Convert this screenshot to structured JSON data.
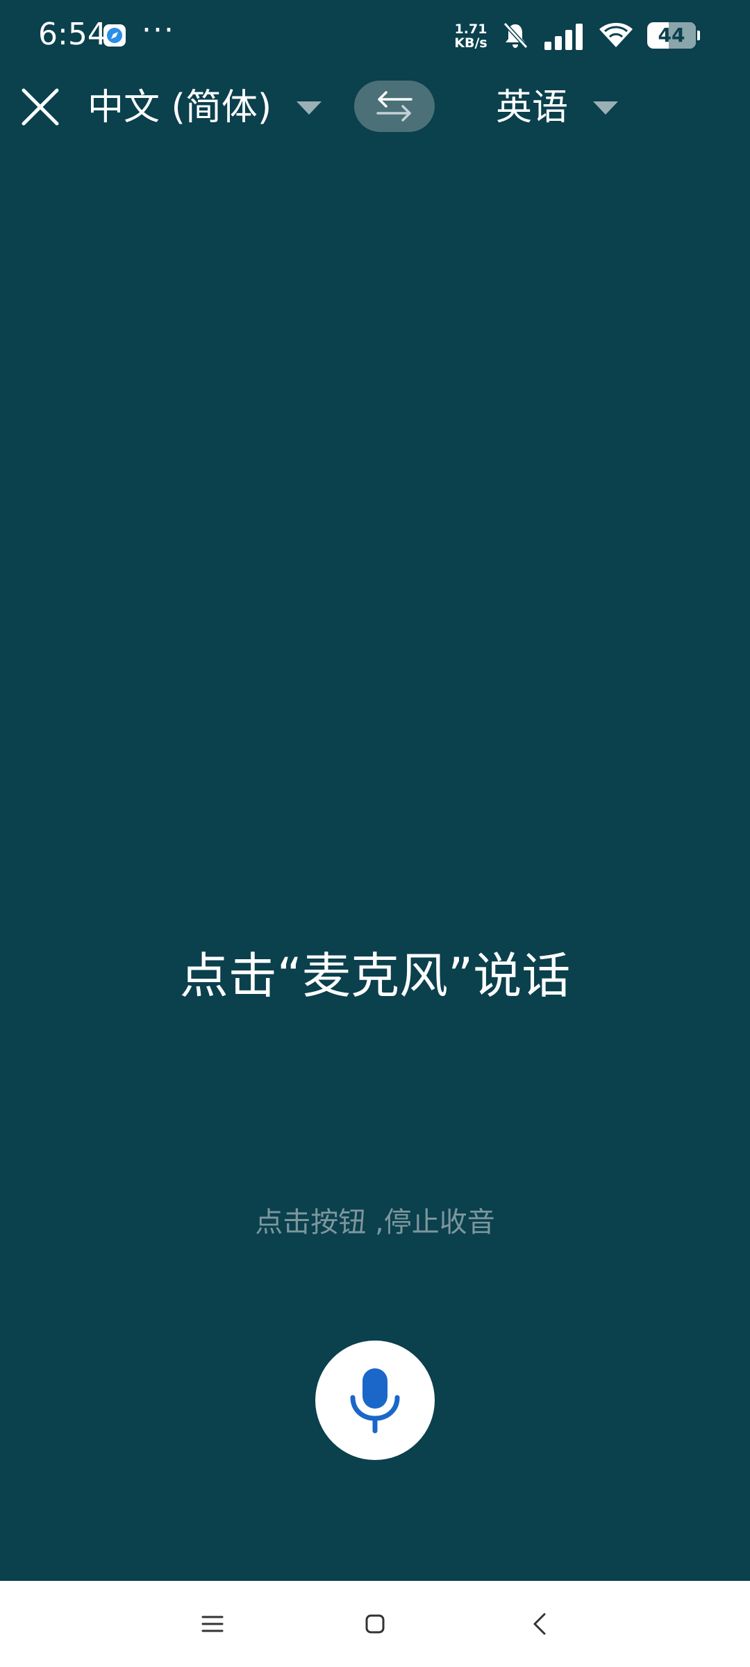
{
  "status_bar": {
    "time": "6:54",
    "app_icon": "browser-app-icon",
    "more": "···",
    "net_speed_value": "1.71",
    "net_speed_unit": "KB/s",
    "battery_level": "44",
    "battery_fraction": 0.44,
    "icons": [
      "mute-bell-icon",
      "signal-icon",
      "wifi-icon",
      "battery-icon"
    ]
  },
  "toolbar": {
    "close_icon": "close-icon",
    "source_language": "中文 (简体)",
    "target_language": "英语",
    "dropdown_icon": "triangle-down-icon",
    "swap_icon": "swap-arrows-icon"
  },
  "main": {
    "prompt": "点击“麦克风”说话",
    "hint": "点击按钮 ,停止收音",
    "mic_icon": "microphone-icon"
  },
  "nav_bar": {
    "menu_icon": "menu-icon",
    "home_icon": "home-icon",
    "back_icon": "back-icon"
  },
  "colors": {
    "background": "#0b404d",
    "swap_button": "#4b7078",
    "hint_text": "#7c979d",
    "mic_icon": "#1a67c9",
    "nav_bar": "#ffffff"
  }
}
